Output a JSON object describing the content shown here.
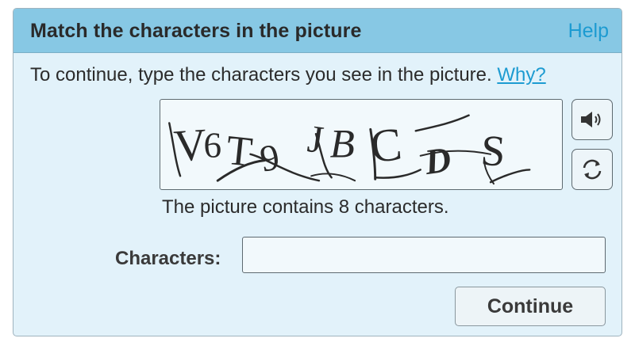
{
  "header": {
    "title": "Match the characters in the picture",
    "help_label": "Help"
  },
  "instruction": {
    "text": "To continue, type the characters you see in the picture.",
    "why_label": "Why?"
  },
  "captcha": {
    "characters": [
      "V",
      "6",
      "T",
      "9",
      "J",
      "B",
      "C",
      "D",
      "S"
    ],
    "count_text": "The picture contains 8 characters."
  },
  "controls": {
    "audio_icon": "speaker-icon",
    "refresh_icon": "refresh-icon"
  },
  "form": {
    "characters_label": "Characters:",
    "characters_value": "",
    "characters_placeholder": "",
    "continue_label": "Continue"
  },
  "colors": {
    "header_bg": "#87c8e4",
    "panel_bg": "#e2f2fa",
    "link": "#1d9bd1"
  }
}
